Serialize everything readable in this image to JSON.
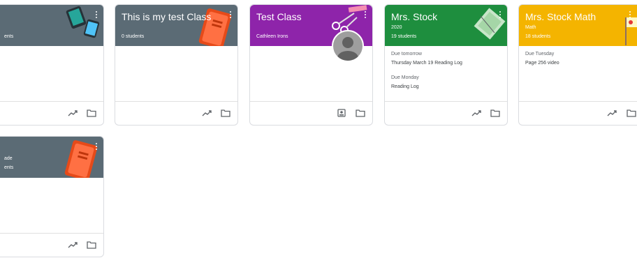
{
  "cards": [
    {
      "title": "",
      "sub1": "",
      "sub2": "ents"
    },
    {
      "title": "This is my test Class",
      "sub1": "0 students"
    },
    {
      "title": "Test Class",
      "sub1": "Cathleen Irons"
    },
    {
      "title": "Mrs. Stock",
      "sub1": "2020",
      "sub2": "19 students",
      "due": [
        {
          "label": "Due tomorrow",
          "value": "Thursday March 19 Reading Log"
        },
        {
          "label": "Due Monday",
          "value": "Reading Log"
        }
      ]
    },
    {
      "title": "Mrs. Stock Math",
      "sub1": "Math",
      "sub2": "18 students",
      "due": [
        {
          "label": "Due Tuesday",
          "value": "Page 256 video"
        }
      ]
    },
    {
      "title": "",
      "sub1": "ade",
      "sub2": "ents"
    }
  ],
  "icons": {
    "trend": "trending-up-icon",
    "folder": "folder-icon",
    "portfolio": "assignment-ind-icon"
  },
  "colors": {
    "slate": "#5b6b75",
    "purple": "#8e24aa",
    "green": "#1e8e3e",
    "yellow": "#f4b400"
  }
}
